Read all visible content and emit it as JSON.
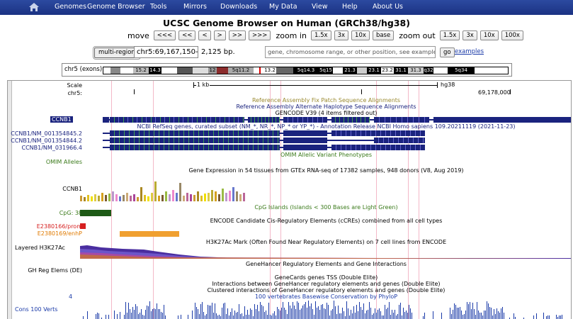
{
  "nav": {
    "items": [
      "Genomes",
      "Genome Browser",
      "Tools",
      "Mirrors",
      "Downloads",
      "My Data",
      "View",
      "Help",
      "About Us"
    ]
  },
  "title": "UCSC Genome Browser on Human (GRCh38/hg38)",
  "controls": {
    "move_label": "move",
    "move_buttons": [
      "<<<",
      "<<",
      "<",
      ">",
      ">>",
      ">>>"
    ],
    "zoom_in_label": "zoom in",
    "zoom_in_buttons": [
      "1.5x",
      "3x",
      "10x",
      "base"
    ],
    "zoom_out_label": "zoom out",
    "zoom_out_buttons": [
      "1.5x",
      "3x",
      "10x",
      "100x"
    ],
    "multi_region": "multi-region",
    "position": "chr5:69,167,150-69,178,245",
    "size_text": "2,125 bp.",
    "search_placeholder": "gene, chromosome range, or other position, see examples",
    "go": "go",
    "examples": "examples"
  },
  "ideogram": {
    "label": "chr5 (exons)",
    "bands": [
      "15.2",
      "14.3",
      "12",
      "5q11.2",
      "13.2",
      "5q14.3",
      "5q15",
      "21.3",
      "23.1",
      "23.2",
      "31.1",
      "31.3",
      "q32",
      "5q34"
    ]
  },
  "tracks": {
    "scale_label": "Scale",
    "chrom_label": "chr5:",
    "scale_value": "1 kb",
    "assembly": "hg38",
    "coord": "69,178,000",
    "fix_patch": "Reference Assembly Fix Patch Sequence Alignments",
    "alt_haplo": "Reference Assembly Alternate Haplotype Sequence Alignments",
    "gencode": "GENCODE V39 (4 items filtered out)",
    "ccnb1": "CCNB1",
    "refseq": "NCBI RefSeq genes, curated subset (NM_*, NR_*, NP_* or YP_*) - Annotation Release NCBI Homo sapiens 109.20211119 (2021-11-23)",
    "refseq_items": [
      "CCNB1/NM_001354845.2",
      "CCNB1/NM_001354844.2",
      "CCNB1/NM_031966.4"
    ],
    "omim_center": "OMIM Allelic Variant Phenotypes",
    "omim_label": "OMIM Alleles",
    "gtex": "Gene Expression in 54 tissues from GTEx RNA-seq of 17382 samples, 948 donors (V8, Aug 2019)",
    "gtex_label": "CCNB1",
    "cpg_center": "CpG Islands (Islands < 300 Bases are Light Green)",
    "cpg_label": "CpG: 38",
    "encode": "ENCODE Candidate Cis-Regulatory Elements (cCREs) combined from all cell types",
    "encode_items": [
      "E2380166/prom",
      "E2380169/enhP"
    ],
    "h3k27_center": "H3K27Ac Mark (Often Found Near Regulatory Elements) on 7 cell lines from ENCODE",
    "h3k27_label": "Layered H3K27Ac",
    "genehancer": "GeneHancer Regulatory Elements and Gene Interactions",
    "gh_label": "GH Reg Elems (DE)",
    "genecards": "GeneCards genes TSS (Double Elite)",
    "gh_interactions": "Interactions between GeneHancer regulatory elements and genes (Double Elite)",
    "gh_clustered": "Clustered interactions of GeneHancer regulatory elements and genes (Double Elite)",
    "cons_center": "100 vertebrates Basewise Conservation by PhyloP",
    "cons_scale": "4",
    "cons_label": "Cons 100 Verts"
  }
}
